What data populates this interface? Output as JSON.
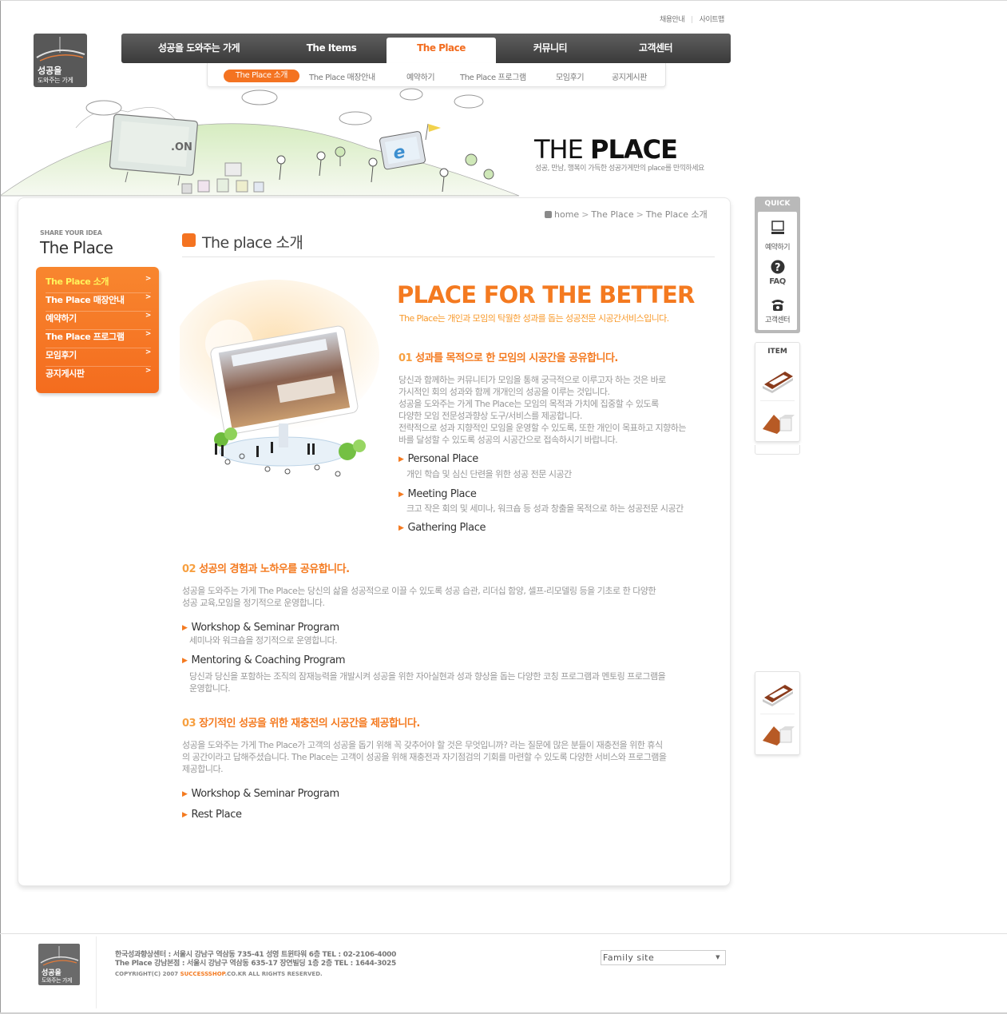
{
  "top_links": {
    "recruit": "채용안내",
    "sitemap": "사이트맵"
  },
  "logo": {
    "line1": "성공을",
    "line2": "도와주는 가게"
  },
  "gnb": {
    "items": [
      "성공을 도와주는 가게",
      "The Items",
      "The Place",
      "커뮤니티",
      "고객센터"
    ],
    "active": "The Place"
  },
  "subnav": {
    "items": [
      "The Place 소개",
      "The Place 매장안내",
      "예약하기",
      "The Place 프로그램",
      "모임후기",
      "공지게시판"
    ]
  },
  "hero": {
    "title_light": "THE ",
    "title_bold": "PLACE",
    "subtitle": "성공, 만남, 행복이 가득한 성공가게만의 place를 만끽하세요",
    "billboard_text": ".ON",
    "badge_letter": "e"
  },
  "lnb": {
    "caption": "SHARE YOUR IDEA",
    "title": "The Place",
    "items": [
      "The Place 소개",
      "The Place 매장안내",
      "예약하기",
      "The Place 프로그램",
      "모임후기",
      "공지게시판"
    ],
    "arrow": ">"
  },
  "breadcrumb": {
    "home": "home",
    "level1": "The Place",
    "level2": "The Place 소개",
    "sep": ">"
  },
  "page_title": "The place 소개",
  "headline": "PLACE FOR THE BETTER",
  "headline_sub": "The Place는 개인과 모임의 탁월한 성과를 돕는 성공전문 시공간서비스입니다.",
  "sections": [
    {
      "num": "01",
      "heading": "성과를 목적으로 한 모임의 시공간을 공유합니다.",
      "body": [
        "당신과 함께하는 커뮤니티가 모임을 통해 궁극적으로 이루고자 하는 것은 바로",
        "가시적인 회의 성과와 함께 개개인의 성공을 이루는 것입니다.",
        "성공을 도와주는 가게 The Place는 모임의 목적과 가치에 집중할 수 있도록",
        "다양한 모임 전문성과향상 도구/서비스를 제공합니다.",
        "전략적으로 성과 지향적인 모임을 운영할 수 있도록, 또한 개인이 목표하고 지향하는",
        "바를 달성할 수 있도록 성공의 시공간으로 접속하시기 바랍니다."
      ],
      "bullets": [
        {
          "title": "Personal Place",
          "desc": "개인 학습 및 심신 단련을 위한 성공 전문 시공간"
        },
        {
          "title": "Meeting Place",
          "desc": "크고 작은 회의 및 세미나, 워크숍 등 성과 창출을 목적으로 하는 성공전문 시공간"
        },
        {
          "title": "Gathering Place",
          "desc": ""
        }
      ]
    },
    {
      "num": "02",
      "heading": "성공의 경험과 노하우를 공유합니다.",
      "body": [
        "성공을 도와주는 가게 The Place는 당신의 삶을 성공적으로 이끌 수 있도록 성공 습관, 리더십 함양, 셀프-리모델링 등을 기초로 한 다양한",
        "성공 교육,모임을 정기적으로 운영합니다."
      ],
      "bullets": [
        {
          "title": "Workshop & Seminar Program",
          "desc": "세미나와 워크숍을 정기적으로 운영합니다."
        },
        {
          "title": "Mentoring & Coaching Program",
          "desc": "당신과 당신을 포함하는 조직의 잠재능력을 개발시켜 성공을 위한 자아실현과 성과 향상을 돕는 다양한 코칭 프로그램과 멘토링 프로그램을",
          "desc2": "운영합니다."
        }
      ]
    },
    {
      "num": "03",
      "heading": "장기적인 성공을 위한 재충전의 시공간을 제공합니다.",
      "body": [
        "성공을 도와주는 가게 The Place가 고객의 성공을 돕기 위해 꼭 갖추어야 할 것은 무엇입니까? 라는 질문에 많은 분들이 재충전을 위한 휴식",
        "의 공간이라고 답해주셨습니다. The Place는 고객이 성공을 위해 재충전과 자기점검의 기회를 마련할 수 있도록 다양한 서비스와 프로그램을",
        "제공합니다."
      ],
      "bullets": [
        {
          "title": "Workshop & Seminar Program",
          "desc": ""
        },
        {
          "title": "Rest Place",
          "desc": ""
        }
      ]
    }
  ],
  "quick": {
    "caption": "QUICK",
    "items": [
      "예약하기",
      "FAQ",
      "고객센터"
    ]
  },
  "item_box": {
    "caption": "ITEM"
  },
  "footer": {
    "address1": "한국성과향상센터 : 서울시 강남구 역삼동 735-41 성영 트윈타워 6층 TEL : 02-2106-4000",
    "address2": "The Place 강남본점 : 서울시 강남구 역삼동 635-17 장연빌딩 1층 2층 TEL : 1644-3025",
    "copy_prefix": "COPYRIGHT(C) 2007 ",
    "copy_brand": "SUCCESSSHOP",
    "copy_suffix": ".CO.KR   ALL RIGHTS RESERVED.",
    "family_site": "Family site"
  },
  "colors": {
    "accent": "#f47a20",
    "nav_dark": "#4a4a4a",
    "highlight": "#fff45c"
  }
}
